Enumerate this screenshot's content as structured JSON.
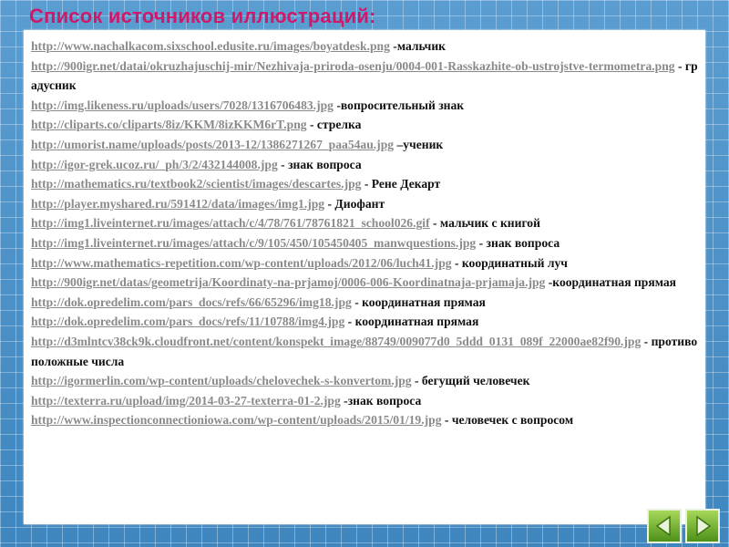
{
  "title": "Список источников иллюстраций:",
  "entries": [
    {
      "url": "http://www.nachalkacom.sixschool.edusite.ru/images/boyatdesk.png",
      "desc": " -мальчик"
    },
    {
      "url": "http://900igr.net/datai/okruzhajuschij-mir/Nezhivaja-priroda-osenju/0004-001-Rasskazhite-ob-ustrojstve-termometra.png",
      "desc": " - градусник"
    },
    {
      "url": "http://img.likeness.ru/uploads/users/7028/1316706483.jpg",
      "desc": " -вопросительный знак"
    },
    {
      "url": "http://cliparts.co/cliparts/8iz/KKM/8izKKM6rT.png",
      "desc": " - стрелка"
    },
    {
      "url": "http://umorist.name/uploads/posts/2013-12/1386271267_paa54au.jpg",
      "desc": " –ученик"
    },
    {
      "url": "http://igor-grek.ucoz.ru/_ph/3/2/432144008.jpg",
      "desc": " - знак вопроса"
    },
    {
      "url": "http://mathematics.ru/textbook2/scientist/images/descartes.jpg",
      "desc": " - Рене Декарт"
    },
    {
      "url": "http://player.myshared.ru/591412/data/images/img1.jpg",
      "desc": " - Диофант"
    },
    {
      "url": "http://img1.liveinternet.ru/images/attach/c/4/78/761/78761821_school026.gif",
      "desc": " - мальчик с книгой"
    },
    {
      "url": "http://img1.liveinternet.ru/images/attach/c/9/105/450/105450405_manwquestions.jpg",
      "desc": " - знак вопроса"
    },
    {
      "url": "http://www.mathematics-repetition.com/wp-content/uploads/2012/06/luch41.jpg",
      "desc": " - координатный луч"
    },
    {
      "url": "http://900igr.net/datas/geometrija/Koordinaty-na-prjamoj/0006-006-Koordinatnaja-prjamaja.jpg",
      "desc": " -координатная прямая"
    },
    {
      "url": "http://dok.opredelim.com/pars_docs/refs/66/65296/img18.jpg",
      "desc": " - координатная прямая"
    },
    {
      "url": "http://dok.opredelim.com/pars_docs/refs/11/10788/img4.jpg",
      "desc": " - координатная прямая"
    },
    {
      "url": "http://d3mlntcv38ck9k.cloudfront.net/content/konspekt_image/88749/009077d0_5ddd_0131_089f_22000ae82f90.jpg",
      "desc": " - противоположные числа"
    },
    {
      "url": "http://igormerlin.com/wp-content/uploads/chelovechek-s-konvertom.jpg",
      "desc": " - бегущий человечек"
    },
    {
      "url": "http://texterra.ru/upload/img/2014-03-27-texterra-01-2.jpg",
      "desc": " -знак вопроса"
    },
    {
      "url": "http://www.inspectionconnectioniowa.com/wp-content/uploads/2015/01/19.jpg",
      "desc": " - человечек  с вопросом"
    }
  ],
  "nav": {
    "prev_icon": "back-arrow-icon",
    "next_icon": "forward-arrow-icon",
    "accent": "#d0186b",
    "button_color": "#7bbf2f"
  }
}
